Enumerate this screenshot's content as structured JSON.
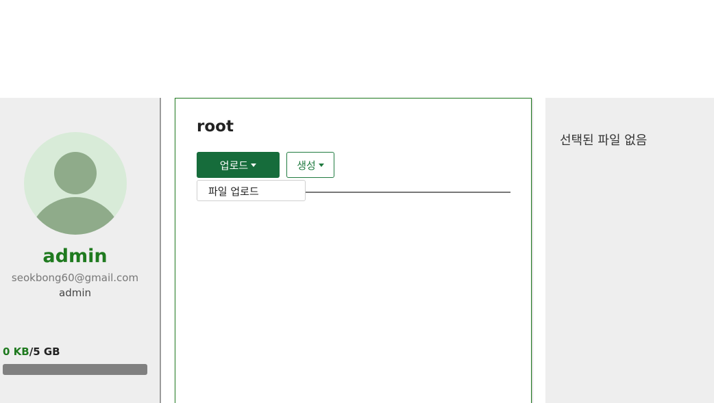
{
  "profile": {
    "name": "admin",
    "email": "seokbong60@gmail.com",
    "role": "admin"
  },
  "storage": {
    "used": "0 KB",
    "total": "/5 GB",
    "used_fraction": 0
  },
  "file_panel": {
    "folder_title": "root",
    "upload_button_label": "업로드",
    "create_button_label": "생성",
    "upload_menu": {
      "items": [
        {
          "label": "파일 업로드"
        }
      ]
    }
  },
  "details_panel": {
    "empty_text": "선택된 파일 없음"
  },
  "colors": {
    "accent": "#1f7a1f",
    "button_primary": "#166c3b",
    "panel_bg": "#eeeeee",
    "avatar_bg": "#d8ebd8",
    "avatar_fg": "#8fab8a"
  },
  "icons": {
    "avatar": "user-avatar-icon",
    "caret": "caret-down-icon"
  }
}
